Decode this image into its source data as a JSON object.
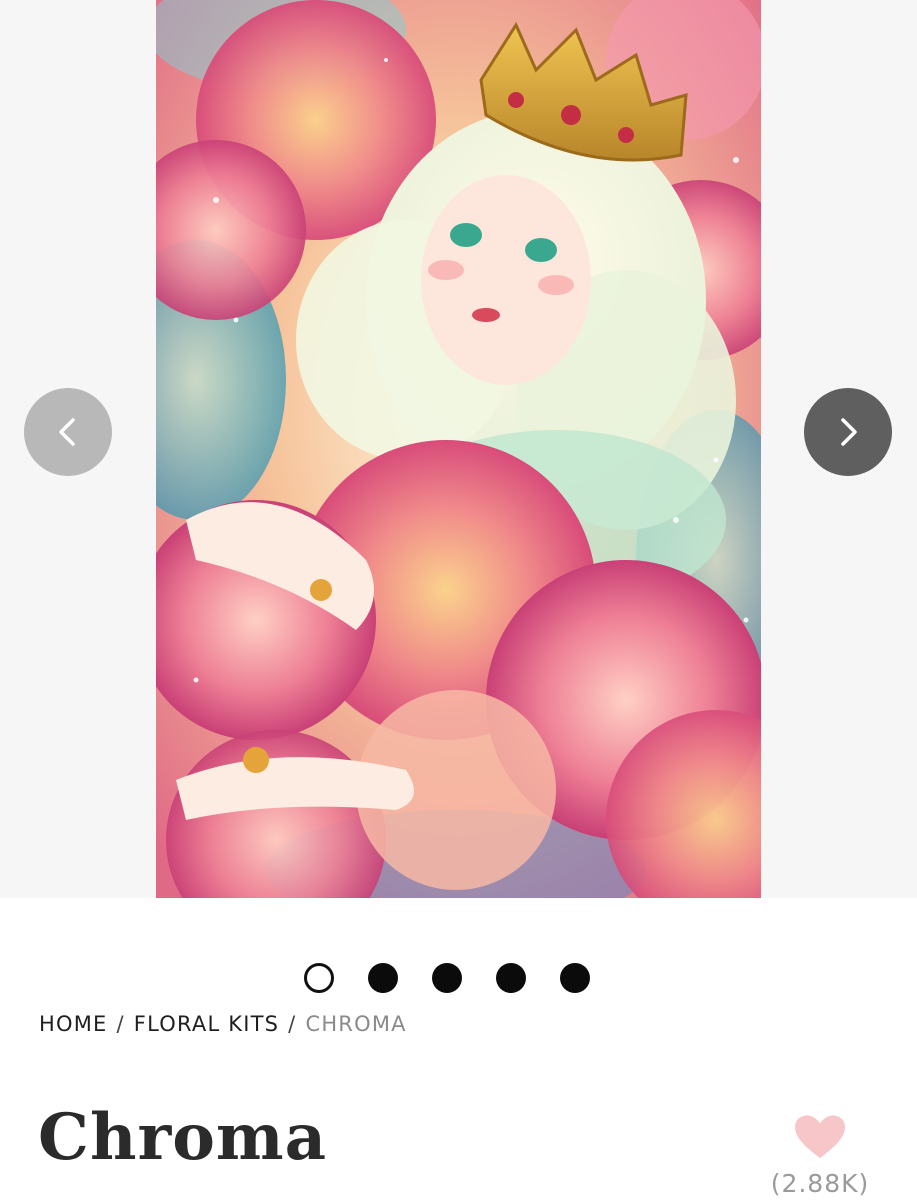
{
  "gallery": {
    "artwork_alt": "artwork",
    "prev_icon": "chevron-left-icon",
    "next_icon": "chevron-right-icon",
    "slide_count": 5,
    "active_slide": 1
  },
  "breadcrumb": {
    "home": "HOME",
    "separator": "/",
    "category": "FLORAL KITS",
    "current": "CHROMA"
  },
  "product": {
    "title": "Chroma",
    "favorite_icon": "heart-icon",
    "favorite_count": "(2.88K)"
  },
  "colors": {
    "heart": "#f6c6c8",
    "prev_button": "#b8b8b8",
    "next_button": "#5f5f5f"
  }
}
